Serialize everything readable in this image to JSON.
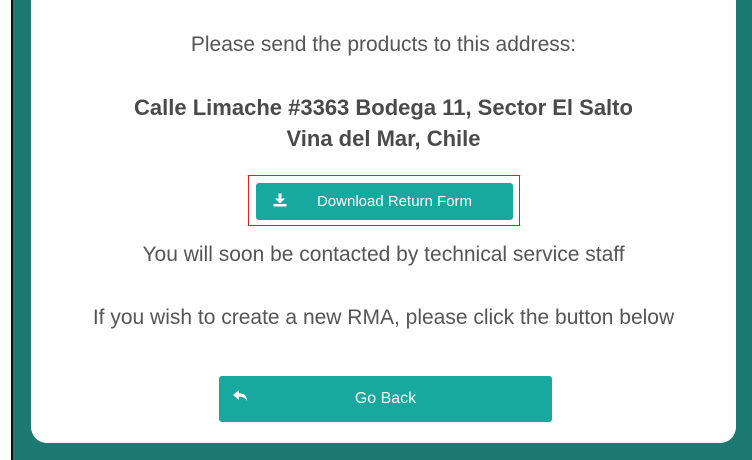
{
  "instruction": "Please send the products to this address:",
  "address": {
    "line1": "Calle Limache #3363 Bodega 11, Sector El Salto",
    "line2": "Vina del Mar, Chile"
  },
  "download_button": {
    "label": "Download Return Form",
    "icon": "download-icon"
  },
  "contact_message": "You will soon be contacted by technical service staff",
  "new_rma_message": "If you wish to create a new RMA, please click the button below",
  "back_button": {
    "label": "Go Back",
    "icon": "reply-arrow-icon"
  },
  "colors": {
    "page_background": "#1d7a73",
    "button": "#17a8a0",
    "highlight": "#e02020",
    "text": "#555555"
  }
}
